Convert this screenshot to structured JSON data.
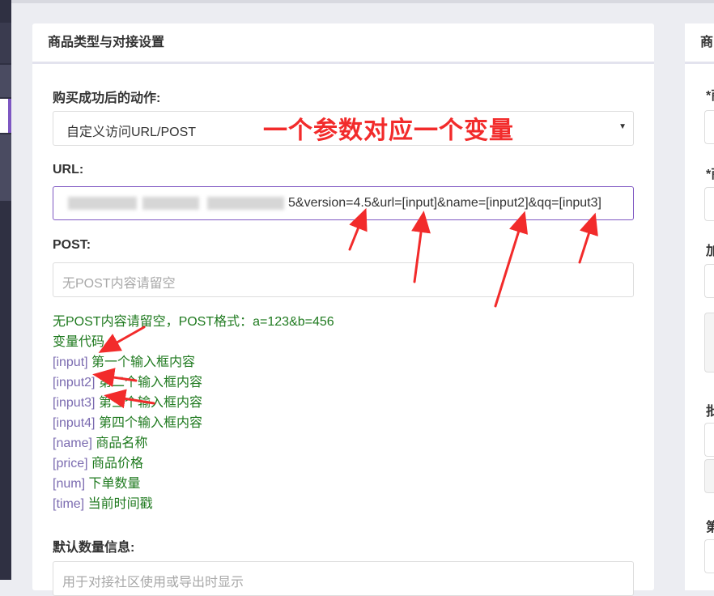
{
  "left_card": {
    "title": "商品类型与对接设置",
    "action_label": "购买成功后的动作:",
    "action_selected": "自定义访问URL/POST",
    "url_label": "URL:",
    "url_visible": "5&version=4.5&url=[input]&name=[input2]&qq=[input3]",
    "post_label": "POST:",
    "post_placeholder": "无POST内容请留空",
    "help": {
      "line1": "无POST内容请留空，POST格式：a=123&b=456",
      "line2": "变量代码",
      "vars": [
        {
          "code": "[input]",
          "desc": "第一个输入框内容"
        },
        {
          "code": "[input2]",
          "desc": "第二个输入框内容"
        },
        {
          "code": "[input3]",
          "desc": "第三个输入框内容"
        },
        {
          "code": "[input4]",
          "desc": "第四个输入框内容"
        },
        {
          "code": "[name]",
          "desc": "商品名称"
        },
        {
          "code": "[price]",
          "desc": "商品价格"
        },
        {
          "code": "[num]",
          "desc": "下单数量"
        },
        {
          "code": "[time]",
          "desc": "当前时间戳"
        }
      ]
    },
    "default_qty_label": "默认数量信息:",
    "default_qty_placeholder": "用于对接社区使用或导出时显示"
  },
  "right_card": {
    "title": "商",
    "labels": [
      "*商",
      "*商",
      "加",
      "批",
      "第"
    ]
  },
  "annotation": {
    "text": "一个参数对应一个变量",
    "color": "#f22b2b"
  },
  "colors": {
    "accent": "#7e57c2",
    "help_text": "#1f7a1f",
    "var_code": "#7b6bb0"
  }
}
